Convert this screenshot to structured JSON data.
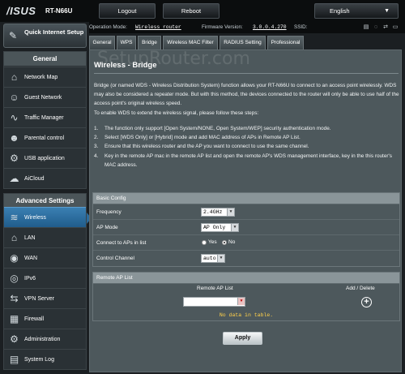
{
  "header": {
    "brand": "/ISUS",
    "model": "RT-N66U",
    "logout": "Logout",
    "reboot": "Reboot",
    "language": "English"
  },
  "status_bar": {
    "op_mode_label": "Operation Mode:",
    "op_mode_value": "Wireless router",
    "firmware_label": "Firmware Version:",
    "firmware_value": "3.0.0.4.270",
    "ssid_label": "SSID:"
  },
  "sidebar": {
    "quick_setup": "Quick Internet Setup",
    "general_header": "General",
    "general_items": [
      {
        "label": "Network Map",
        "icon": "network-map-icon"
      },
      {
        "label": "Guest Network",
        "icon": "guest-network-icon"
      },
      {
        "label": "Traffic Manager",
        "icon": "traffic-manager-icon"
      },
      {
        "label": "Parental control",
        "icon": "parental-control-icon"
      },
      {
        "label": "USB application",
        "icon": "usb-icon"
      },
      {
        "label": "AiCloud",
        "icon": "cloud-icon"
      }
    ],
    "advanced_header": "Advanced Settings",
    "advanced_items": [
      {
        "label": "Wireless",
        "icon": "wireless-icon",
        "active": true
      },
      {
        "label": "LAN",
        "icon": "lan-icon"
      },
      {
        "label": "WAN",
        "icon": "wan-icon"
      },
      {
        "label": "IPv6",
        "icon": "ipv6-icon"
      },
      {
        "label": "VPN Server",
        "icon": "vpn-icon"
      },
      {
        "label": "Firewall",
        "icon": "firewall-icon"
      },
      {
        "label": "Administration",
        "icon": "administration-icon"
      },
      {
        "label": "System Log",
        "icon": "system-log-icon"
      }
    ]
  },
  "tabs": [
    "General",
    "WPS",
    "Bridge",
    "Wireless MAC Filter",
    "RADIUS Setting",
    "Professional"
  ],
  "active_tab": "Bridge",
  "page": {
    "title": "Wireless - Bridge",
    "description": "Bridge (or named WDS - Wireless Distribution System) function allows your RT-N66U to connect to an access point wirelessly. WDS may also be considered a repeater mode. But with this method, the devices connected to the router will only be able to use half of the access point's original wireless speed.\nTo enable WDS to extend the wireless signal, please follow these steps:",
    "steps": [
      "The function only support [Open System/NONE, Open System/WEP] security authentication mode.",
      "Select [WDS Only] or [Hybrid] mode and add MAC address of APs in Remote AP List.",
      "Ensure that this wireless router and the AP you want to connect to use the same channel.",
      "Key in the remote AP mac in the remote AP list and open the remote AP's WDS management interface, key in the this router's MAC address."
    ]
  },
  "basic_config": {
    "header": "Basic Config",
    "frequency_label": "Frequency",
    "frequency_value": "2.4GHz",
    "ap_mode_label": "AP Mode",
    "ap_mode_value": "AP Only",
    "connect_label": "Connect to APs in list",
    "yes_label": "Yes",
    "no_label": "No",
    "connect_selected": "No",
    "channel_label": "Control Channel",
    "channel_value": "auto"
  },
  "remote_ap": {
    "header": "Remote AP List",
    "col_list": "Remote AP List",
    "col_action": "Add / Delete",
    "add_symbol": "+",
    "empty_text": "No data in table."
  },
  "apply_label": "Apply",
  "watermark": "SetupRouter.com"
}
